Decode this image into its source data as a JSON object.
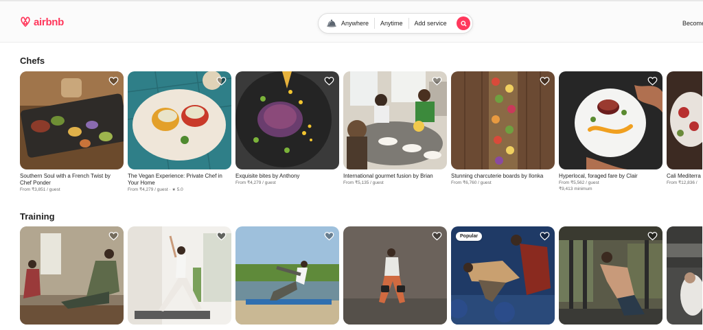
{
  "header": {
    "logo_text": "airbnb",
    "search": {
      "where": "Anywhere",
      "when": "Anytime",
      "what": "Add service"
    },
    "become": "Become"
  },
  "colors": {
    "brand": "#ff385c"
  },
  "sections": [
    {
      "title": "Chefs",
      "cards": [
        {
          "title": "Southern Soul with a French Twist by Chef Ponder",
          "price": "From ₹3,851 / guest",
          "extra": ""
        },
        {
          "title": "The Vegan Experience: Private Chef in Your Home",
          "price": "From ₹4,279 / guest",
          "rating": "5.0"
        },
        {
          "title": "Exquisite bites by Anthony",
          "price": "From ₹4,279 / guest",
          "extra": ""
        },
        {
          "title": "International gourmet fusion by Brian",
          "price": "From ₹5,135 / guest",
          "extra": ""
        },
        {
          "title": "Stunning charcuterie boards by Ilonka",
          "price": "From ₹6,760 / guest",
          "extra": ""
        },
        {
          "title": "Hyperlocal, foraged fare by Clair",
          "price": "From ₹5,562 / guest",
          "extra": "₹9,413 minimum"
        },
        {
          "title": "Cali Mediterra",
          "price": "From ₹12,836 /",
          "extra": ""
        }
      ]
    },
    {
      "title": "Training",
      "cards": [
        {
          "badge": ""
        },
        {
          "badge": ""
        },
        {
          "badge": ""
        },
        {
          "badge": ""
        },
        {
          "badge": "Popular"
        },
        {
          "badge": ""
        },
        {
          "badge": ""
        }
      ]
    }
  ]
}
